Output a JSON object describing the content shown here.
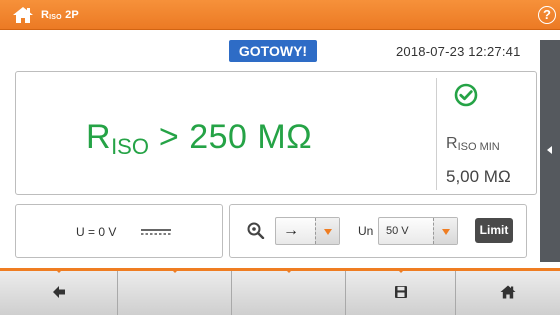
{
  "header": {
    "title_main": "R",
    "title_sub": "ISO",
    "title_suffix": " 2P",
    "help_label": "?"
  },
  "status": {
    "state": "GOTOWY!",
    "datetime": "2018-07-23 12:27:41"
  },
  "result": {
    "symbol": "R",
    "symbol_sub": "ISO",
    "comparator": " > ",
    "value": "250 MΩ",
    "ok": true
  },
  "limit_info": {
    "label": "R",
    "label_sub": "ISO MIN",
    "value": "5,00 MΩ"
  },
  "voltage": {
    "text": "U = 0 V"
  },
  "controls": {
    "direction_value": "→",
    "un_label": "Un",
    "un_value": "50 V",
    "limit_label": "Limit"
  },
  "colors": {
    "accent": "#ef7d22",
    "status_blue": "#2e6cc6",
    "result_green": "#25a346",
    "side_tab": "#55595e"
  },
  "nav": {
    "items": [
      "back-icon",
      "blank",
      "blank",
      "save-icon",
      "home-icon"
    ]
  }
}
